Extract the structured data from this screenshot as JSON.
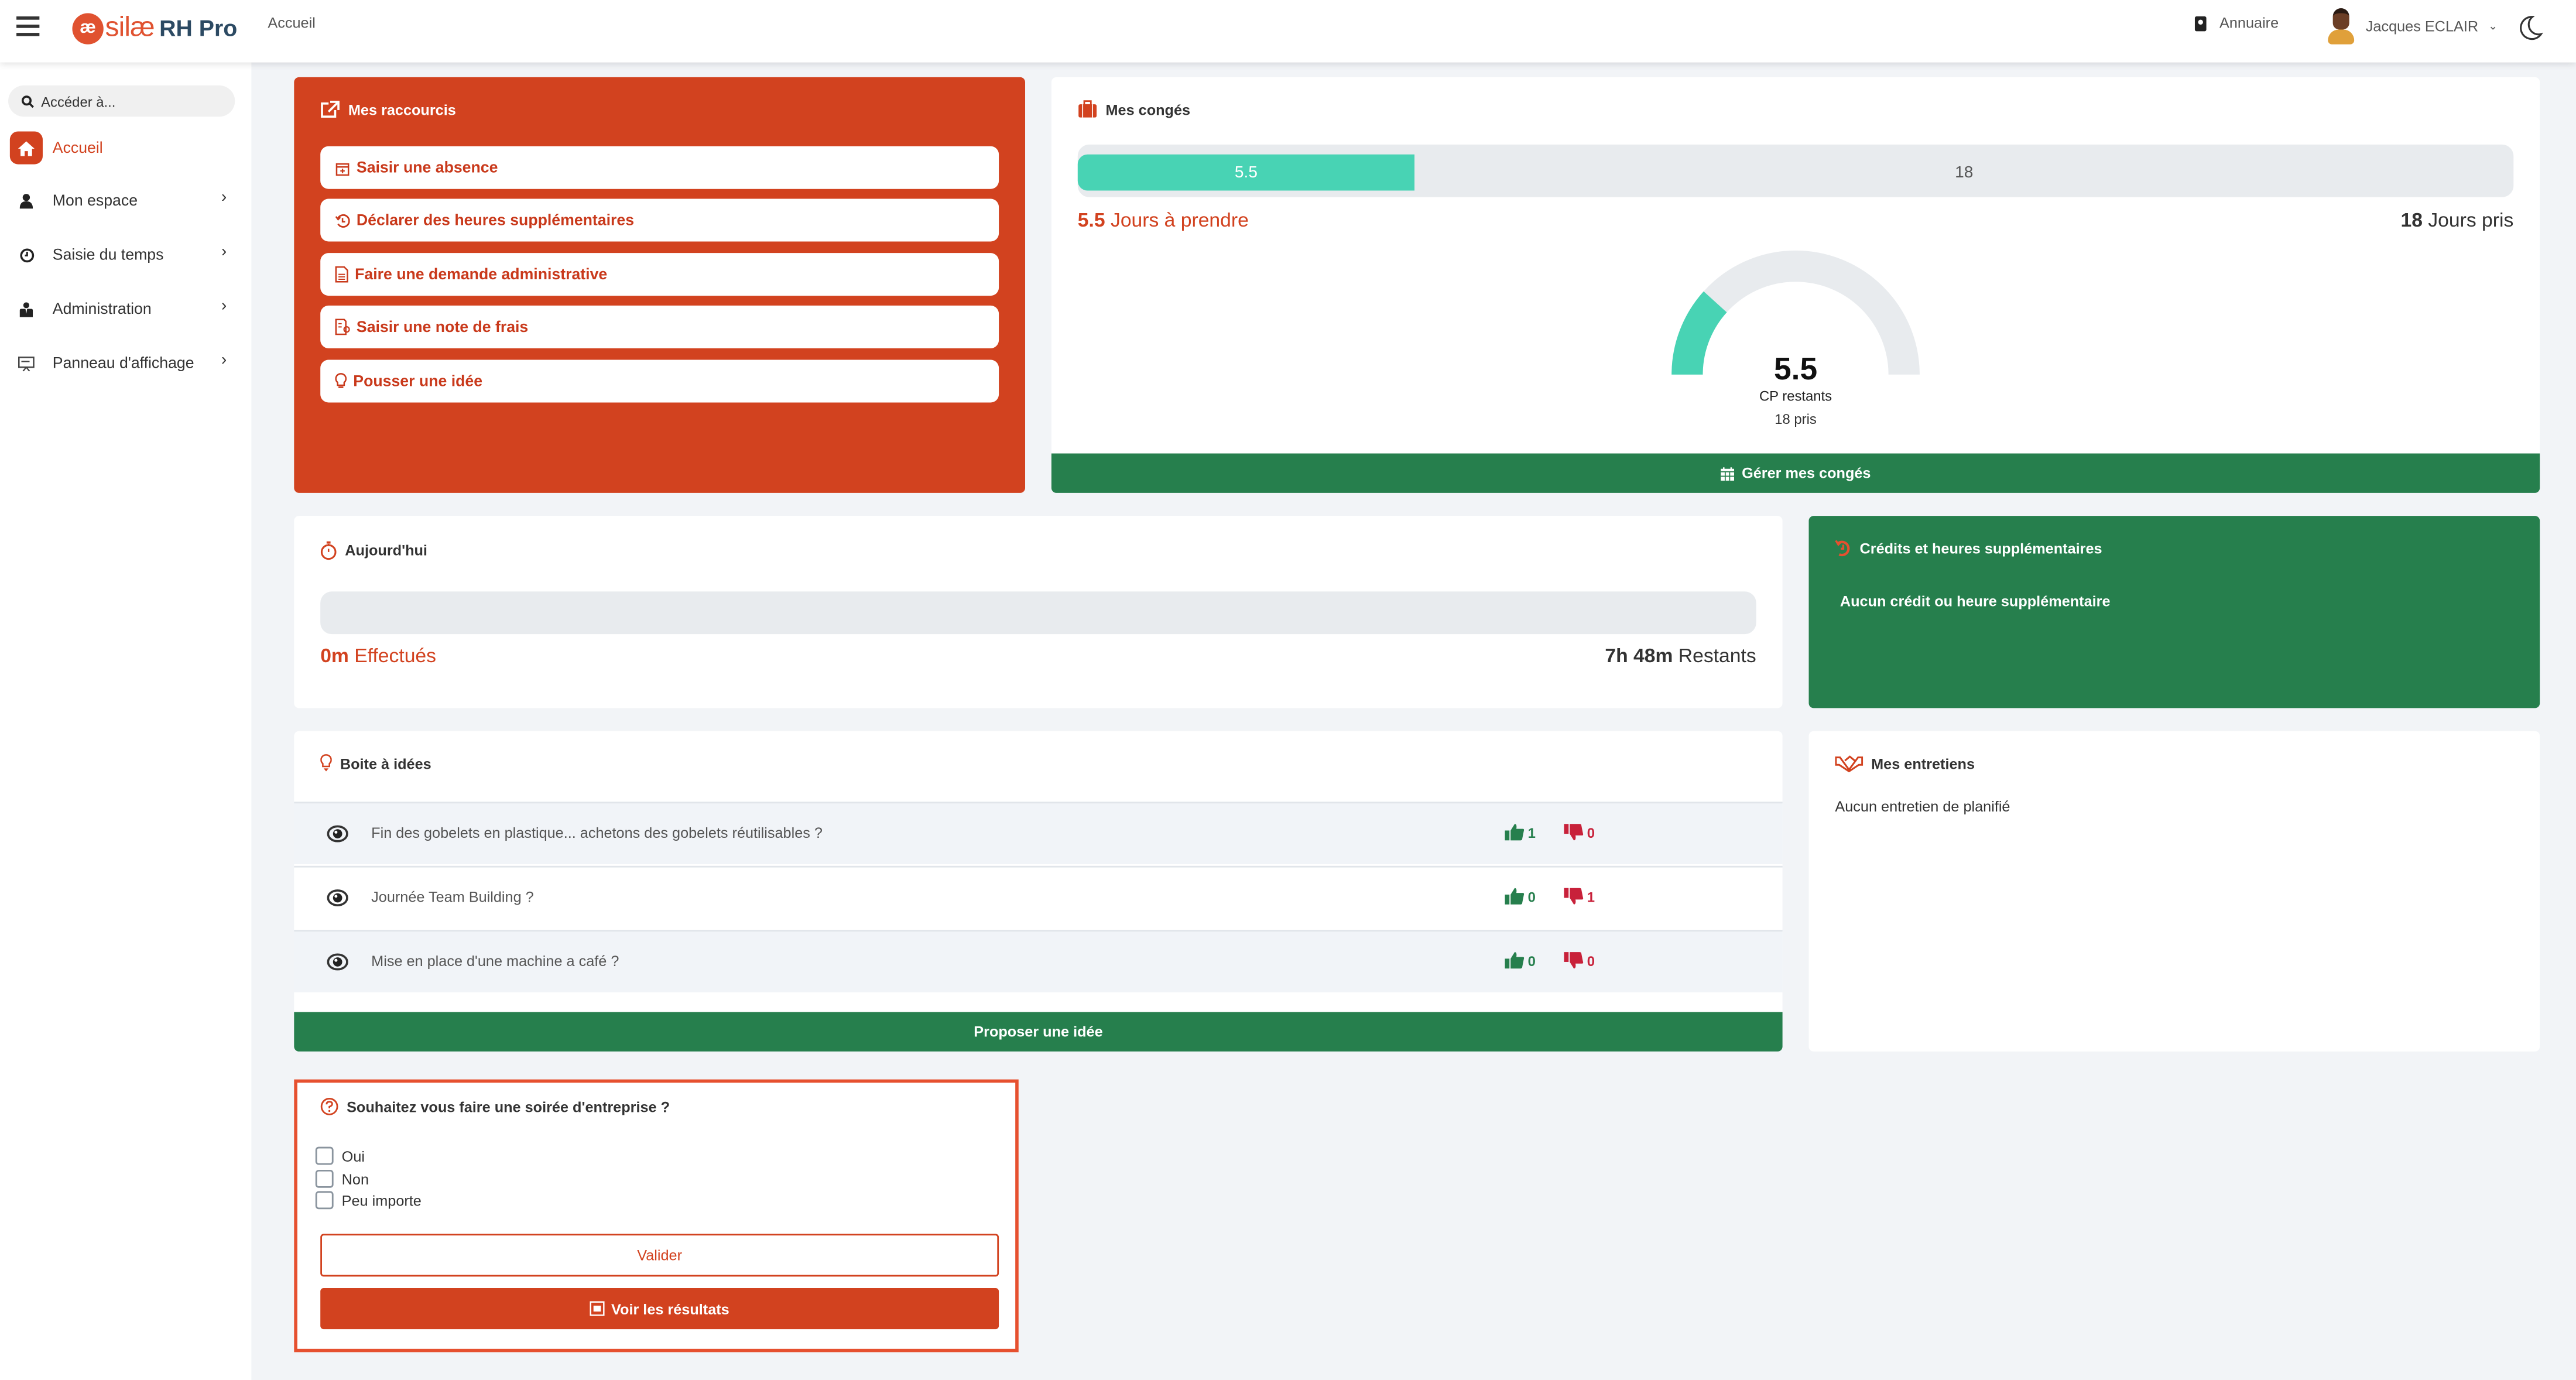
{
  "header": {
    "logo_mark": "æ",
    "logo_brand": "silæ",
    "logo_product": "RH Pro",
    "breadcrumb": "Accueil",
    "annuaire": "Annuaire",
    "user_name": "Jacques ECLAIR",
    "user_caret": "⌄"
  },
  "sidebar": {
    "search_placeholder": "Accéder à...",
    "items": [
      {
        "label": "Accueil",
        "icon": "home-icon",
        "active": true
      },
      {
        "label": "Mon espace",
        "icon": "user-icon",
        "chevron": "›"
      },
      {
        "label": "Saisie du temps",
        "icon": "clock-icon",
        "chevron": "›"
      },
      {
        "label": "Administration",
        "icon": "admin-icon",
        "chevron": "›"
      },
      {
        "label": "Panneau d'affichage",
        "icon": "board-icon",
        "chevron": "›"
      }
    ]
  },
  "raccourcis": {
    "title": "Mes raccourcis",
    "items": [
      {
        "label": "Saisir une absence",
        "icon": "calendar-plus-icon"
      },
      {
        "label": "Déclarer des heures supplémentaires",
        "icon": "history-icon"
      },
      {
        "label": "Faire une demande administrative",
        "icon": "document-icon"
      },
      {
        "label": "Saisir une note de frais",
        "icon": "receipt-icon"
      },
      {
        "label": "Pousser une idée",
        "icon": "lightbulb-icon"
      }
    ]
  },
  "conges": {
    "title": "Mes congés",
    "remaining": 5.5,
    "taken": 18,
    "remaining_label": "5.5",
    "taken_label": "18",
    "remaining_num": "5.5",
    "remaining_text": " Jours à prendre",
    "taken_num": "18",
    "taken_text": " Jours pris",
    "gauge_value": "5.5",
    "gauge_label": "CP restants",
    "gauge_sub": "18 pris",
    "manage_button": "Gérer mes congés"
  },
  "aujourdhui": {
    "title": "Aujourd'hui",
    "done_fraction": 0,
    "done_num": "0m",
    "done_text": " Effectués",
    "remaining_num": "7h 48m",
    "remaining_text": " Restants"
  },
  "credits": {
    "title": "Crédits et heures supplémentaires",
    "empty": "Aucun crédit ou heure supplémentaire"
  },
  "idees": {
    "title": "Boite à idées",
    "items": [
      {
        "text": "Fin des gobelets en plastique... achetons des gobelets réutilisables ?",
        "up": "1",
        "down": "0"
      },
      {
        "text": "Journée Team Building ?",
        "up": "0",
        "down": "1"
      },
      {
        "text": "Mise en place d'une machine a café ?",
        "up": "0",
        "down": "0"
      }
    ],
    "propose_button": "Proposer une idée"
  },
  "entretiens": {
    "title": "Mes entretiens",
    "empty": "Aucun entretien de planifié"
  },
  "sondage": {
    "question": "Souhaitez vous faire une soirée d'entreprise ?",
    "options": [
      "Oui",
      "Non",
      "Peu importe"
    ],
    "submit": "Valider",
    "results": "Voir les résultats"
  },
  "colors": {
    "brand_red": "#d2421f",
    "brand_green": "#267f4d",
    "teal": "#48d3b4",
    "vote_down": "#c8213a"
  }
}
